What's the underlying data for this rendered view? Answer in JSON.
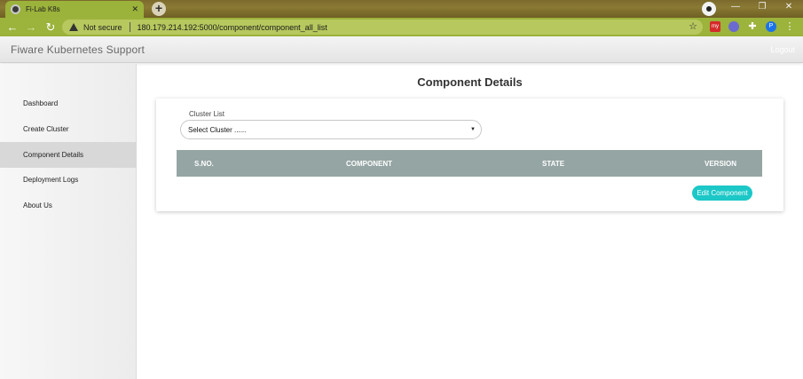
{
  "browser": {
    "tab_title": "Fi-Lab K8s",
    "tab_close": "✕",
    "new_tab": "+",
    "security_label": "Not secure",
    "url": "180.179.214.192:5000/component/component_all_list",
    "ext_my": "my",
    "ext_profile": "P"
  },
  "header": {
    "title": "Fiware Kubernetes Support",
    "logout_label": "Logout"
  },
  "sidebar": {
    "items": [
      {
        "label": "Dashboard",
        "active": false
      },
      {
        "label": "Create Cluster",
        "active": false
      },
      {
        "label": "Component Details",
        "active": true
      },
      {
        "label": "Deployment Logs",
        "active": false
      },
      {
        "label": "About Us",
        "active": false
      }
    ]
  },
  "main": {
    "title": "Component Details",
    "cluster_list_label": "Cluster List",
    "cluster_select_value": "Select Cluster ......",
    "table_headers": [
      "S.NO.",
      "COMPONENT",
      "STATE",
      "VERSION"
    ],
    "edit_button_label": "Edit Component"
  },
  "colors": {
    "table_header": "#95a5a3",
    "accent_button": "#1cc7c7",
    "chrome_green": "#9cb33c"
  }
}
